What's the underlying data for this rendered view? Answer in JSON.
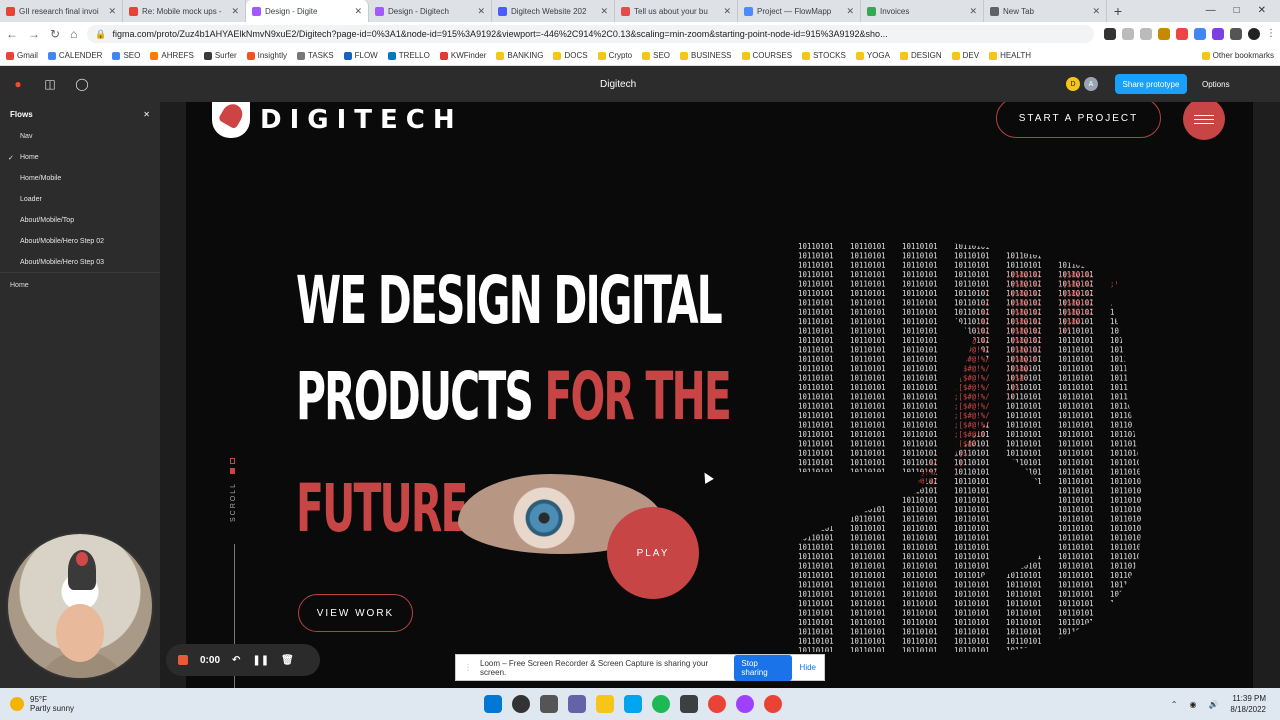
{
  "browser": {
    "tabs": [
      {
        "title": "GII research final invoi",
        "color": "#ea4335"
      },
      {
        "title": "Re: Mobile mock ups -",
        "color": "#ea4335"
      },
      {
        "title": "Design - Digite",
        "color": "#a259ff"
      },
      {
        "title": "Design - Digitech",
        "color": "#a259ff"
      },
      {
        "title": "Digitech Website 202",
        "color": "#4a5cff"
      },
      {
        "title": "Tell us about your bu",
        "color": "#e54b4b"
      },
      {
        "title": "Project — FlowMapp",
        "color": "#4a8cff"
      },
      {
        "title": "Invoices",
        "color": "#34a853"
      },
      {
        "title": "New Tab",
        "color": "#5f6368"
      }
    ],
    "active_tab": 2,
    "url": "figma.com/proto/Zuz4b1AHYAElkNmvN9xuE2/Digitech?page-id=0%3A1&node-id=915%3A9192&viewport=-446%2C914%2C0.13&scaling=min-zoom&starting-point-node-id=915%3A9192&sho...",
    "bookmarks": [
      "Gmail",
      "CALENDER",
      "SEO",
      "AHREFS",
      "Surfer",
      "Insightly",
      "TASKS",
      "FLOW",
      "TRELLO",
      "KWFinder",
      "BANKING",
      "DOCS",
      "Crypto",
      "SEO",
      "BUSINESS",
      "COURSES",
      "STOCKS",
      "YOGA",
      "DESIGN",
      "DEV",
      "HEALTH"
    ],
    "other_bookmarks": "Other bookmarks"
  },
  "figma": {
    "doc_title": "Digitech",
    "avatars": [
      "D",
      "A"
    ],
    "share_label": "Share prototype",
    "options_label": "Options",
    "flows_title": "Flows",
    "flows": [
      "Nav",
      "Home",
      "Home/Mobile",
      "Loader",
      "About/Mobile/Top",
      "About/Mobile/Hero Step 02",
      "About/Mobile/Hero Step 03"
    ],
    "selected_flow": "Home",
    "current_frame": "Home"
  },
  "site": {
    "logo_text": "DIGITECH",
    "start_label": "START A PROJECT",
    "hero_line1": "WE DESIGN DIGITAL",
    "hero_line2a": "PRODUCTS ",
    "hero_line2b": "FOR THE",
    "hero_line3": "FUTURE",
    "play_label": "PLAY",
    "scroll_label": "SCROLL",
    "view_work_label": "VIEW WORK",
    "accent": "#c74545"
  },
  "recorder": {
    "time": "0:00"
  },
  "loom": {
    "message": "Loom – Free Screen Recorder & Screen Capture is sharing your screen.",
    "stop_label": "Stop sharing",
    "hide_label": "Hide"
  },
  "taskbar": {
    "temp": "95°F",
    "condition": "Partly sunny",
    "time": "11:39 PM",
    "date": "8/18/2022"
  }
}
